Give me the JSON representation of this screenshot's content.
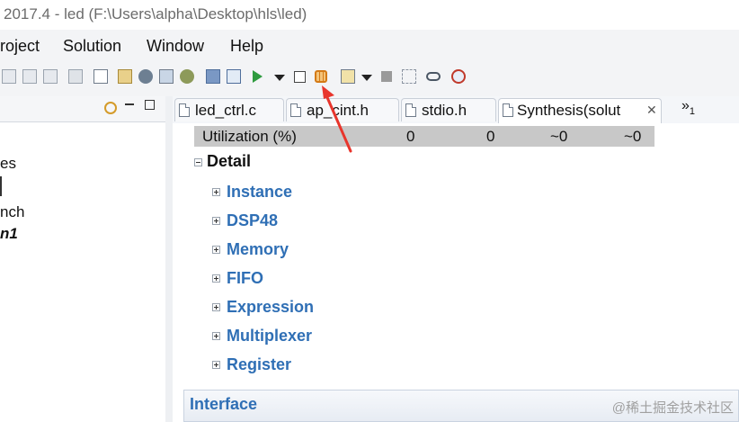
{
  "window": {
    "title": "2017.4 - led (F:\\Users\\alpha\\Desktop\\hls\\led)"
  },
  "menu": {
    "items": [
      "roject",
      "Solution",
      "Window",
      "Help"
    ]
  },
  "left_panel": {
    "lines": [
      "es",
      "nch",
      "n1"
    ]
  },
  "tabs": [
    {
      "label": "led_ctrl.c"
    },
    {
      "label": "ap_cint.h"
    },
    {
      "label": "stdio.h"
    },
    {
      "label": "Synthesis(solut"
    }
  ],
  "overflow_tabs": {
    "label": "»",
    "count": "1"
  },
  "utilization": {
    "label": "Utilization (%)",
    "values": [
      "0",
      "0",
      "~0",
      "~0"
    ]
  },
  "detail": {
    "label": "Detail",
    "sections": [
      "Instance",
      "DSP48",
      "Memory",
      "FIFO",
      "Expression",
      "Multiplexer",
      "Register"
    ]
  },
  "interface": {
    "label": "Interface"
  },
  "watermark": "@稀土掘金技术社区",
  "colors": {
    "link_blue": "#2f6fb5",
    "annotation_red": "#e8352c",
    "util_row_bg": "#c8c8c8"
  }
}
